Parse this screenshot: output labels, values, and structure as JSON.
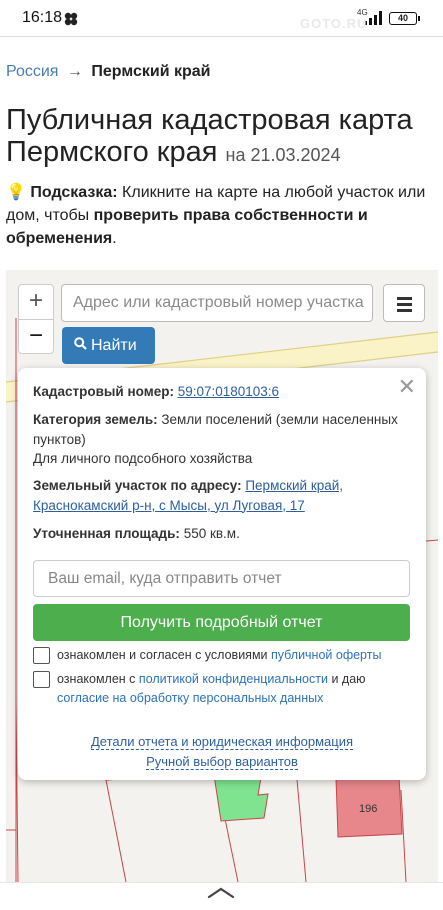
{
  "status": {
    "time": "16:18",
    "network": "4G",
    "battery": "40"
  },
  "watermark": "GOTO.RU",
  "breadcrumb": {
    "root": "Россия",
    "separator": "→",
    "current": "Пермский край"
  },
  "title": {
    "main": "Публичная кадастровая карта Пермского края",
    "date": "на 21.03.2024"
  },
  "hint": {
    "label": "Подсказка:",
    "text": "Кликните на карте на любой участок или дом, чтобы",
    "bold": "проверить права собственности и обременения",
    "end": "."
  },
  "map": {
    "zoom_in": "+",
    "zoom_out": "−",
    "search_placeholder": "Адрес или кадастровый номер участка",
    "find_label": "Найти",
    "parcel_label": "196"
  },
  "popup": {
    "cadastral_label": "Кадастровый номер:",
    "cadastral_value": "59:07:0180103:6",
    "category_label": "Категория земель:",
    "category_value": "Земли поселений (земли населенных пунктов)",
    "usage": "Для личного подсобного хозяйства",
    "address_label": "Земельный участок по адресу:",
    "address_value": "Пермский край, Краснокамский р-н, с Мысы, ул Луговая, 17",
    "area_label": "Уточненная площадь:",
    "area_value": "550 кв.м.",
    "email_placeholder": "Ваш email, куда отправить отчет",
    "report_button": "Получить подробный отчет",
    "check1_text": "ознакомлен и согласен с условиями",
    "check1_link": "публичной оферты",
    "check2_text": "ознакомлен с",
    "check2_link": "политикой конфиденциальности",
    "check2_mid": "и даю",
    "check2_link2": "согласие на обработку персональных данных",
    "details_link": "Детали отчета и юридическая информация",
    "manual_link": "Ручной выбор вариантов"
  },
  "colors": {
    "primary": "#337ab7",
    "success": "#4cae4c",
    "link": "#2d5f9e"
  }
}
